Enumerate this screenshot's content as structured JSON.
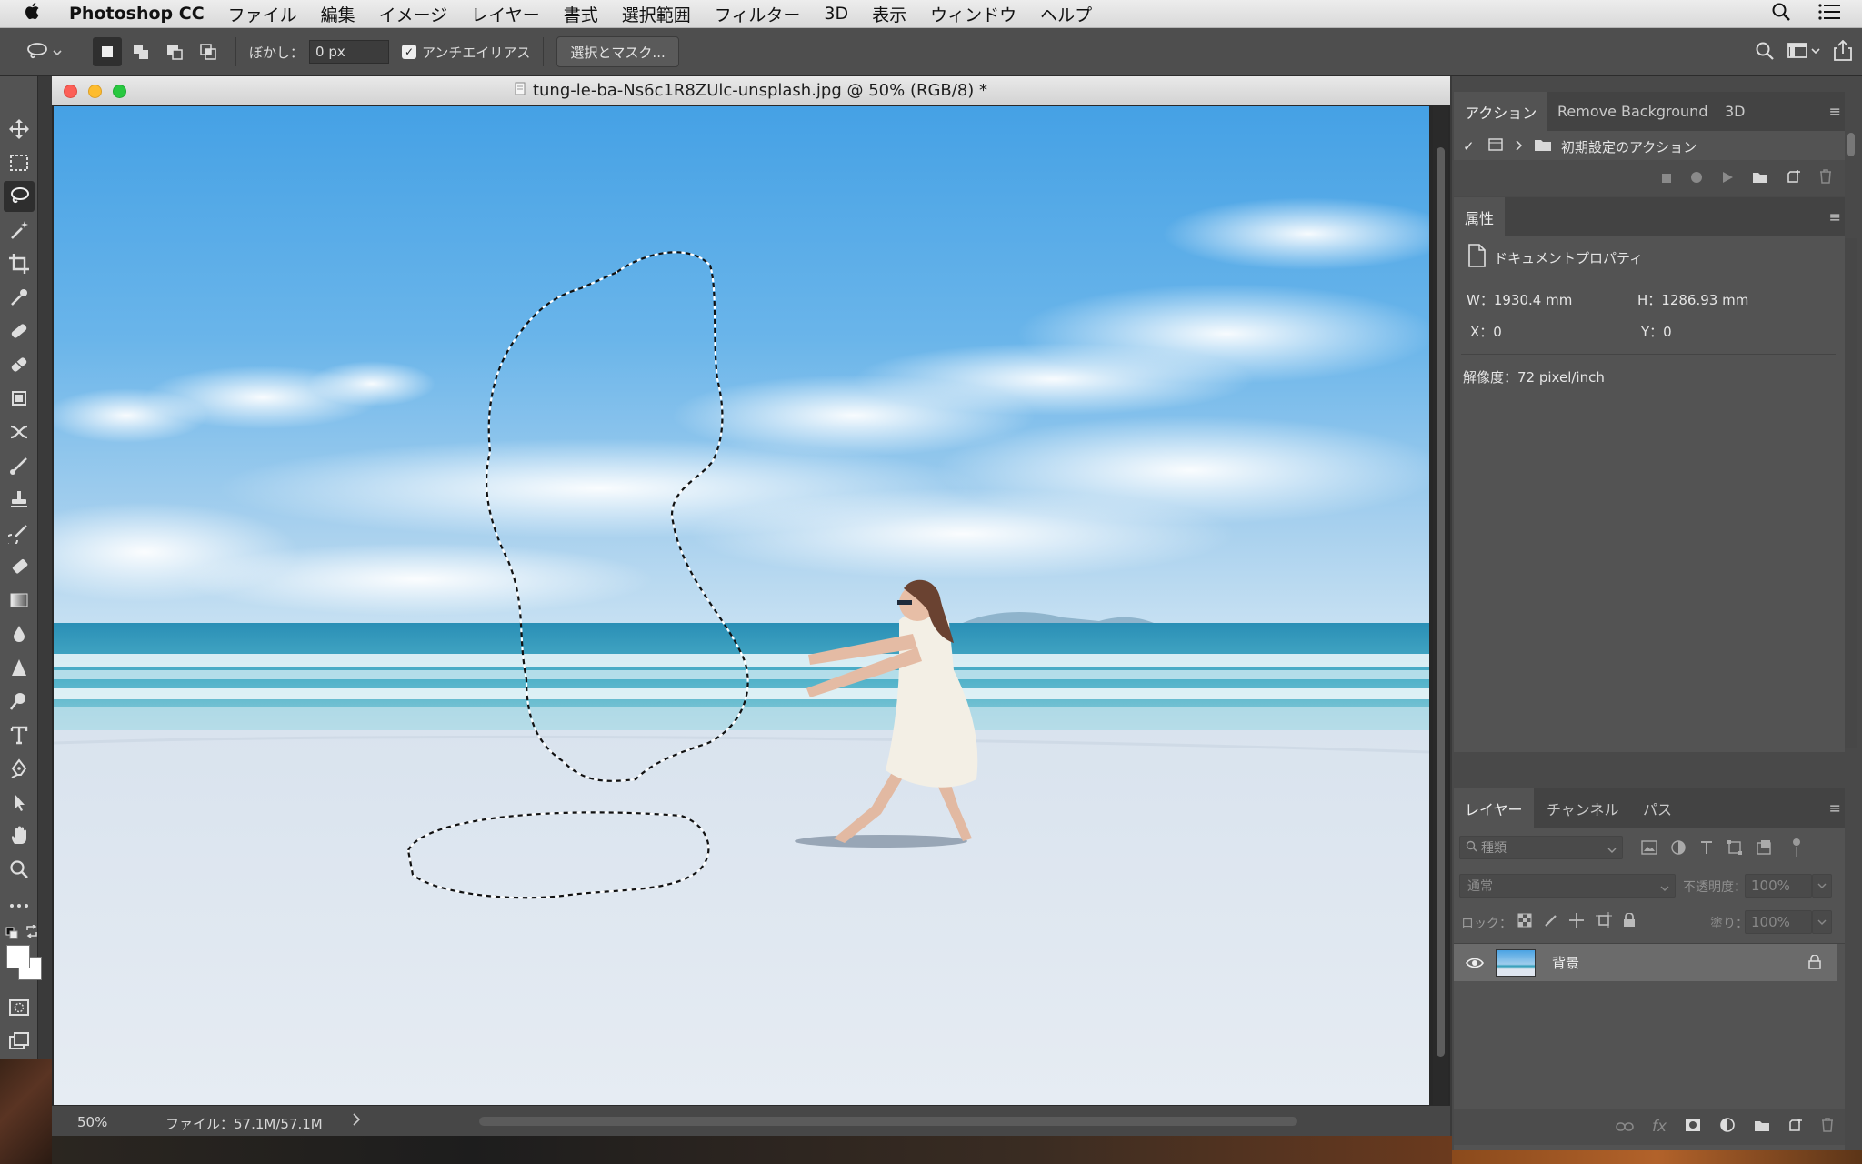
{
  "menubar": {
    "app_name": "Photoshop CC",
    "items": [
      "ファイル",
      "編集",
      "イメージ",
      "レイヤー",
      "書式",
      "選択範囲",
      "フィルター",
      "3D",
      "表示",
      "ウィンドウ",
      "ヘルプ"
    ]
  },
  "options": {
    "feather_label": "ぼかし：",
    "feather_value": "0 px",
    "antialias_label": "アンチエイリアス",
    "antialias_checked": true,
    "select_mask_label": "選択とマスク..."
  },
  "document": {
    "title": "tung-le-ba-Ns6c1R8ZUlc-unsplash.jpg @ 50% (RGB/8) *",
    "zoom": "50%",
    "file_info": "ファイル：57.1M/57.1M",
    "active_tool": "lasso-tool"
  },
  "actions_panel": {
    "tabs": [
      "アクション",
      "Remove Background",
      "3D"
    ],
    "active_tab": "アクション",
    "set_name": "初期設定のアクション"
  },
  "properties_panel": {
    "tab": "属性",
    "title": "ドキュメントプロパティ",
    "w_label": "W：1930.4 mm",
    "h_label": "H：1286.93 mm",
    "x_label": "X：0",
    "y_label": "Y：0",
    "resolution": "解像度：72 pixel/inch"
  },
  "layers_panel": {
    "tabs": [
      "レイヤー",
      "チャンネル",
      "パス"
    ],
    "active_tab": "レイヤー",
    "filter_placeholder": "種類",
    "blend_mode": "通常",
    "opacity_label": "不透明度：",
    "opacity_value": "100%",
    "lock_label": "ロック：",
    "fill_label": "塗り：",
    "fill_value": "100%",
    "layers": [
      {
        "name": "背景",
        "visible": true,
        "locked": true
      }
    ]
  },
  "colors": {
    "sky_top": "#47a3e4",
    "sea": "#2f9db8",
    "sand": "#dfe6f0",
    "panel_bg": "#535353"
  }
}
